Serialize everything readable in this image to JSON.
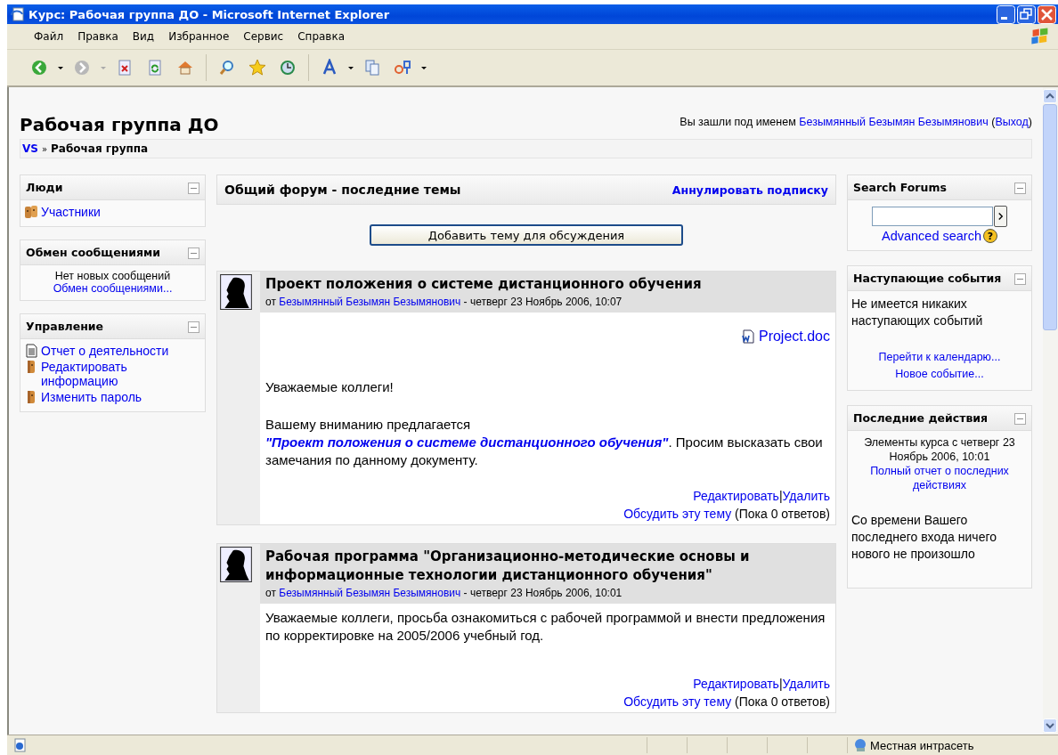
{
  "window": {
    "title": "Курс: Рабочая группа ДО  - Microsoft Internet Explorer"
  },
  "menu": [
    "Файл",
    "Правка",
    "Вид",
    "Избранное",
    "Сервис",
    "Справка"
  ],
  "page": {
    "heading": "Рабочая группа ДО",
    "login": {
      "prefix": "Вы зашли под именем",
      "user": "Безымянный Безымян Безымянович",
      "open": "(",
      "logout": "Выход",
      "close": ")"
    },
    "breadcrumb": {
      "home": "VS",
      "separator": "»",
      "current": "Рабочая группа"
    }
  },
  "left_blocks": [
    {
      "title": "Люди",
      "expanded": true,
      "items": [
        {
          "kind": "people-link",
          "label": "Участники"
        }
      ]
    },
    {
      "title": "Обмен сообщениями",
      "expanded": true,
      "items": [
        {
          "kind": "text",
          "label": "Нет новых сообщений"
        },
        {
          "kind": "center-link",
          "label": "Обмен сообщениями..."
        }
      ]
    },
    {
      "title": "Управление",
      "expanded": true,
      "items": [
        {
          "kind": "report-link",
          "label": "Отчет о деятельности"
        },
        {
          "kind": "person-link",
          "label": "Редактировать информацию"
        },
        {
          "kind": "person-link",
          "label": "Изменить пароль"
        }
      ]
    }
  ],
  "forum": {
    "title": "Общий форум - последние темы",
    "unsubscribe": "Аннулировать подписку",
    "add_button": "Добавить тему для обсуждения",
    "posts": [
      {
        "subject": "Проект положения о системе дистанционного обучения",
        "by": "от",
        "author": "Безымянный Безымян Безымянович",
        "date": "- четверг 23 Ноябрь 2006, 10:07",
        "attachment": "Project.doc",
        "paragraphs": [
          {
            "before": "Уважаемые коллеги!"
          },
          {
            "before": "Вашему вниманию предлагается ",
            "link": "\"Проект положения о системе дистанционного обучения\"",
            "after": ". Просим высказать свои замечания по данному документу."
          }
        ],
        "edit": "Редактировать",
        "separator": "|",
        "delete": "Удалить",
        "discuss": "Обсудить эту тему",
        "replies": "(Пока 0 ответов)"
      },
      {
        "subject": "Рабочая программа \"Организационно-методические основы и информационные технологии дистанционного обучения\"",
        "by": "от",
        "author": "Безымянный Безымян Безымянович",
        "date": "- четверг 23 Ноябрь 2006, 10:01",
        "paragraphs": [
          {
            "before": "Уважаемые коллеги, просьба ознакомиться с рабочей программой и внести предложения по корректировке на 2005/2006 учебный год."
          }
        ],
        "edit": "Редактировать",
        "separator": "|",
        "delete": "Удалить",
        "discuss": "Обсудить эту тему",
        "replies": "(Пока 0 ответов)"
      }
    ]
  },
  "right_blocks": [
    {
      "kind": "search",
      "title": "Search Forums",
      "expanded": true,
      "advanced": "Advanced search",
      "help": "?"
    },
    {
      "kind": "events",
      "title": "Наступающие события",
      "expanded": true,
      "text": "Не имеется никаких наступающих событий",
      "links": [
        "Перейти к календарю...",
        "Новое событие..."
      ]
    },
    {
      "kind": "activity",
      "title": "Последние действия",
      "expanded": true,
      "since": "Элементы курса с четверг 23 Ноябрь 2006, 10:01",
      "link": "Полный отчет о последних действиях",
      "text": "Со времени Вашего последнего входа ничего нового не произошло"
    }
  ],
  "status_bar": {
    "zone": "Местная интрасеть"
  }
}
